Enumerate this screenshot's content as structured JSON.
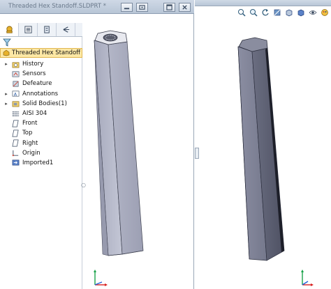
{
  "window": {
    "title_doc": "Threaded Hex Standoff.SLDPRT *"
  },
  "feature_manager": {
    "root_label": "Threaded Hex Standoff  (Defa",
    "items": [
      {
        "label": "History",
        "icon": "history-folder-icon",
        "expandable": true
      },
      {
        "label": "Sensors",
        "icon": "sensors-icon",
        "expandable": false
      },
      {
        "label": "Defeature",
        "icon": "defeature-icon",
        "expandable": false
      },
      {
        "label": "Annotations",
        "icon": "annotations-icon",
        "expandable": true
      },
      {
        "label": "Solid Bodies(1)",
        "icon": "solid-bodies-folder-icon",
        "expandable": true
      },
      {
        "label": "AISI 304",
        "icon": "material-icon",
        "expandable": false
      },
      {
        "label": "Front",
        "icon": "plane-icon",
        "expandable": false
      },
      {
        "label": "Top",
        "icon": "plane-icon",
        "expandable": false
      },
      {
        "label": "Right",
        "icon": "plane-icon",
        "expandable": false
      },
      {
        "label": "Origin",
        "icon": "origin-icon",
        "expandable": false
      },
      {
        "label": "Imported1",
        "icon": "imported-body-icon",
        "expandable": false
      }
    ]
  },
  "colors": {
    "body_face_light": "#b9bccc",
    "body_face_dark": "#8c8fa3",
    "selection_bg": "#fde8a5"
  }
}
